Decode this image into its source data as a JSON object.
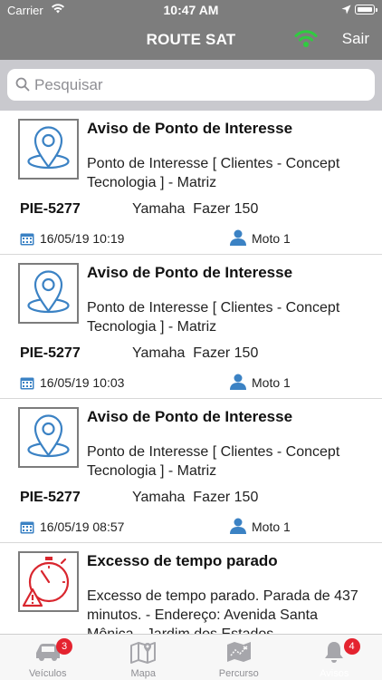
{
  "status_bar": {
    "carrier": "Carrier",
    "time": "10:47 AM"
  },
  "nav": {
    "title": "ROUTE SAT",
    "logout_label": "Sair",
    "signal_color": "#2fcc3f"
  },
  "search": {
    "placeholder": "Pesquisar",
    "value": ""
  },
  "alerts": [
    {
      "icon": "map-pin-icon",
      "title": "Aviso de Ponto de Interesse",
      "description": "Ponto de Interesse [  Clientes - Concept Tecnologia ] - Matriz",
      "plate": "PIE-5277",
      "vehicle": "Yamaha  Fazer 150",
      "datetime": "16/05/19 10:19",
      "driver": "Moto 1"
    },
    {
      "icon": "map-pin-icon",
      "title": "Aviso de Ponto de Interesse",
      "description": "Ponto de Interesse [  Clientes - Concept Tecnologia ] - Matriz",
      "plate": "PIE-5277",
      "vehicle": "Yamaha  Fazer 150",
      "datetime": "16/05/19 10:03",
      "driver": "Moto 1"
    },
    {
      "icon": "map-pin-icon",
      "title": "Aviso de Ponto de Interesse",
      "description": "Ponto de Interesse [  Clientes - Concept Tecnologia ] - Matriz",
      "plate": "PIE-5277",
      "vehicle": "Yamaha  Fazer 150",
      "datetime": "16/05/19 08:57",
      "driver": "Moto 1"
    },
    {
      "icon": "stopwatch-warning-icon",
      "title": "Excesso de tempo parado",
      "description": "Excesso de tempo parado. Parada de 437 minutos. - Endereço: Avenida Santa Mônica - Jardim dos Estados",
      "plate": "",
      "vehicle": "",
      "datetime": "",
      "driver": ""
    }
  ],
  "tabbar": {
    "tabs": [
      {
        "label": "Veículos",
        "icon": "car-icon",
        "badge": "3"
      },
      {
        "label": "Mapa",
        "icon": "map-icon",
        "badge": ""
      },
      {
        "label": "Percurso",
        "icon": "route-map-icon",
        "badge": ""
      },
      {
        "label": "Avisos",
        "icon": "bell-icon",
        "badge": "4",
        "active": true
      }
    ]
  },
  "colors": {
    "header": "#7d7d7d",
    "accent_blue": "#3b82c4",
    "alert_red": "#d9262e",
    "badge_red": "#e4232f"
  }
}
